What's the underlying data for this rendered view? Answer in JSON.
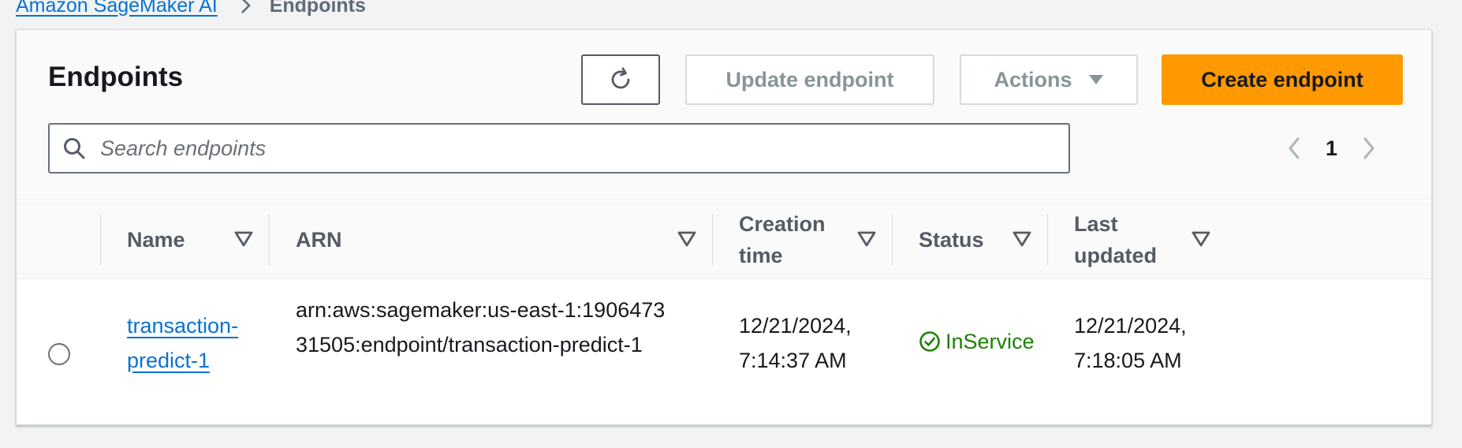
{
  "breadcrumb": {
    "parent": "Amazon SageMaker AI",
    "separator_icon": "chevron-right-icon",
    "current": "Endpoints"
  },
  "header": {
    "title": "Endpoints",
    "refresh_icon": "refresh-icon",
    "update_label": "Update endpoint",
    "actions_label": "Actions",
    "actions_icon": "caret-down-icon",
    "create_label": "Create endpoint"
  },
  "search": {
    "placeholder": "Search endpoints",
    "value": "",
    "icon": "search-icon"
  },
  "pagination": {
    "current_page": "1",
    "prev_icon": "chevron-left-icon",
    "next_icon": "chevron-right-icon"
  },
  "table": {
    "columns": [
      {
        "label": "Name",
        "sortable": true
      },
      {
        "label": "ARN",
        "sortable": true
      },
      {
        "label": "Creation time",
        "sortable": true
      },
      {
        "label": "Status",
        "sortable": true
      },
      {
        "label": "Last updated",
        "sortable": true
      }
    ],
    "rows": [
      {
        "selected": false,
        "name": "transaction-predict-1",
        "arn": "arn:aws:sagemaker:us-east-1:190647331505:endpoint/transaction-predict-1",
        "creation_time": "12/21/2024, 7:14:37 AM",
        "status": "InService",
        "status_icon": "check-circle-icon",
        "last_updated": "12/21/2024, 7:18:05 AM"
      }
    ]
  },
  "colors": {
    "link": "#0972d3",
    "primary_button": "#ff9900",
    "status_ok": "#1d8102",
    "disabled_text": "#879596"
  }
}
